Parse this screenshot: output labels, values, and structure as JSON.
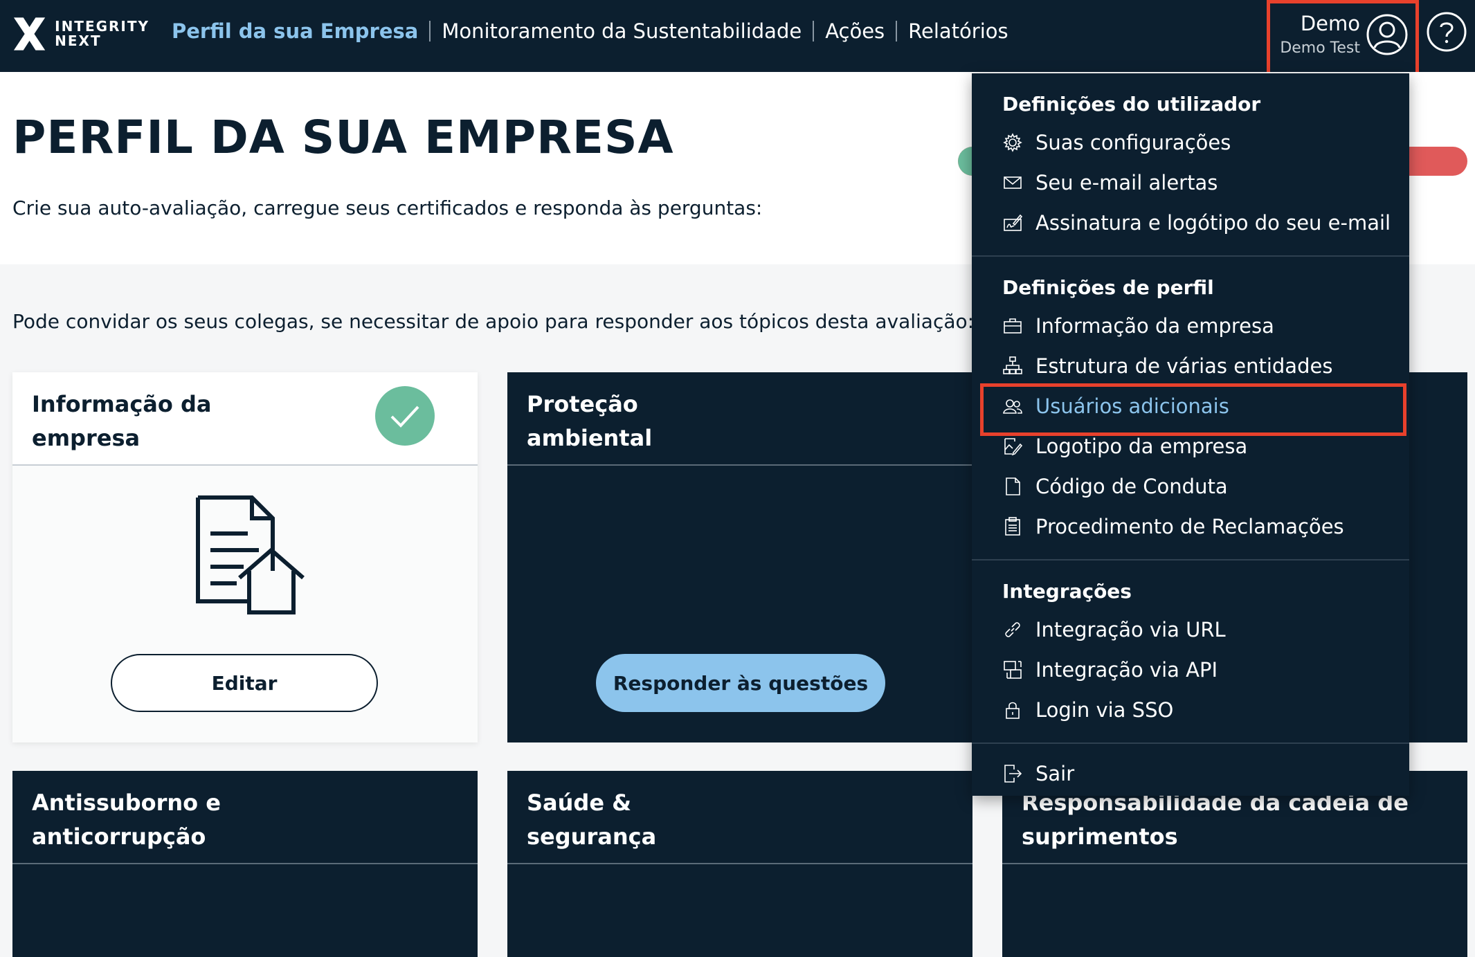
{
  "brand": {
    "line1": "INTEGRITY",
    "line2": "NEXT"
  },
  "nav": {
    "items": [
      {
        "label": "Perfil da sua Empresa",
        "active": true
      },
      {
        "label": "Monitoramento da Sustentabilidade"
      },
      {
        "label": "Ações"
      },
      {
        "label": "Relatórios"
      }
    ]
  },
  "user": {
    "name": "Demo",
    "company": "Demo Test"
  },
  "header": {
    "title": "PERFIL DA SUA EMPRESA",
    "subtitle": "Crie sua auto-avaliação, carregue seus certificados e responda às perguntas:",
    "progress": 0.4
  },
  "invite_text": "Pode convidar os seus colegas, se necessitar de apoio para responder aos tópicos desta avaliação:",
  "cards": [
    {
      "title": "Informação da empresa",
      "status": "completed",
      "button": "Editar"
    },
    {
      "title": "Proteção ambiental",
      "button": "Responder às questões"
    },
    {
      "title": "Antissuborno e anticorrupção"
    },
    {
      "title": "Saúde & segurança"
    },
    {
      "title": "Responsabilidade da cadeia de suprimentos"
    }
  ],
  "menu": {
    "user_settings": {
      "heading": "Definições do utilizador",
      "items": [
        {
          "label": "Suas configurações",
          "icon": "gear-icon"
        },
        {
          "label": "Seu e-mail alertas",
          "icon": "mail-icon"
        },
        {
          "label": "Assinatura e logótipo do seu e-mail",
          "icon": "signature-icon"
        }
      ]
    },
    "profile_settings": {
      "heading": "Definições de perfil",
      "items": [
        {
          "label": "Informação da empresa",
          "icon": "briefcase-icon"
        },
        {
          "label": "Estrutura de várias entidades",
          "icon": "hierarchy-icon"
        },
        {
          "label": "Usuários adicionais",
          "icon": "users-icon",
          "highlighted": true
        },
        {
          "label": "Logotipo da empresa",
          "icon": "image-edit-icon"
        },
        {
          "label": "Código de Conduta",
          "icon": "document-icon"
        },
        {
          "label": "Procedimento de Reclamações",
          "icon": "clipboard-icon"
        }
      ]
    },
    "integrations": {
      "heading": "Integrações",
      "items": [
        {
          "label": "Integração via URL",
          "icon": "link-icon"
        },
        {
          "label": "Integração via API",
          "icon": "api-icon"
        },
        {
          "label": "Login via SSO",
          "icon": "lock-icon"
        }
      ]
    },
    "logout": {
      "label": "Sair",
      "icon": "logout-icon"
    }
  },
  "colors": {
    "navy": "#0c1f2f",
    "accent_blue": "#8cc4ec",
    "success_green": "#6bbd9d",
    "highlight_red": "#e8412c",
    "progress_red": "#e05a5a"
  }
}
